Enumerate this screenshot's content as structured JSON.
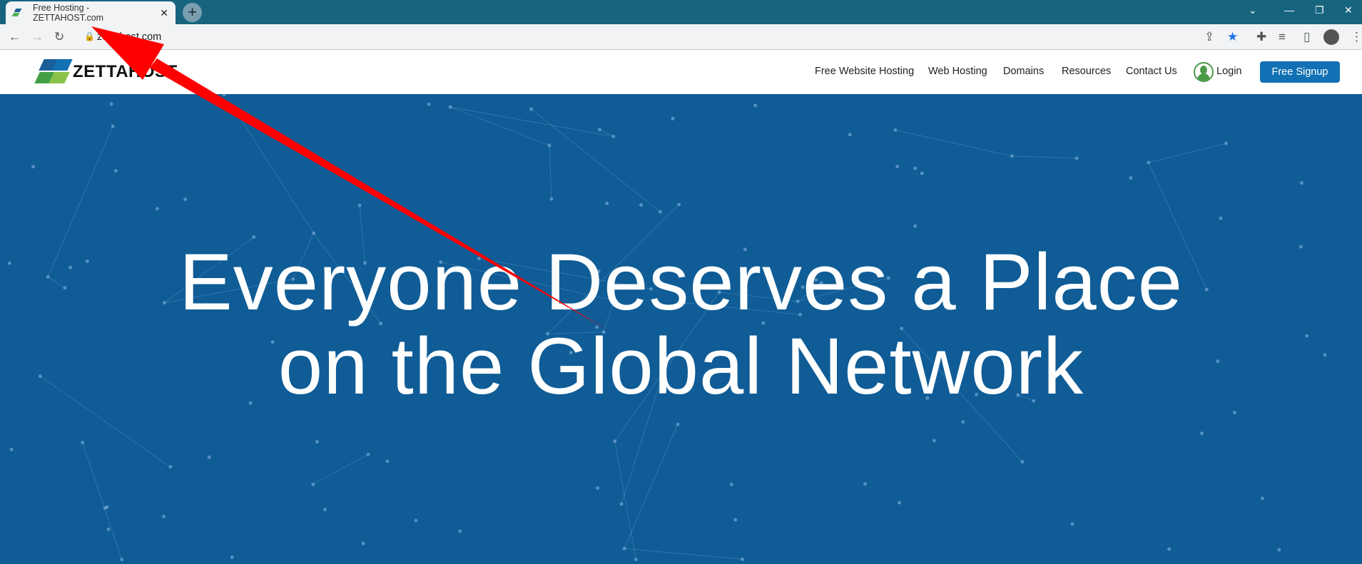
{
  "browser": {
    "tab_title": "Free Hosting - ZETTAHOST.com",
    "url": "zettahost.com",
    "new_tab": "+",
    "close": "✕"
  },
  "site": {
    "logo_text": "ZETTAHOST",
    "nav": [
      "Free Website Hosting",
      "Web Hosting",
      "Domains",
      "Resources",
      "Contact Us"
    ],
    "login": "Login",
    "signup": "Free Signup",
    "hero_line1": "Everyone Deserves a Place",
    "hero_line2": "on the Global Network"
  },
  "colors": {
    "tabbar": "#17647f",
    "brand_blue": "#1271b4",
    "hero_bg": "#0f5c96",
    "annotation_arrow": "#ff0000",
    "login_green": "#4a9a47"
  }
}
